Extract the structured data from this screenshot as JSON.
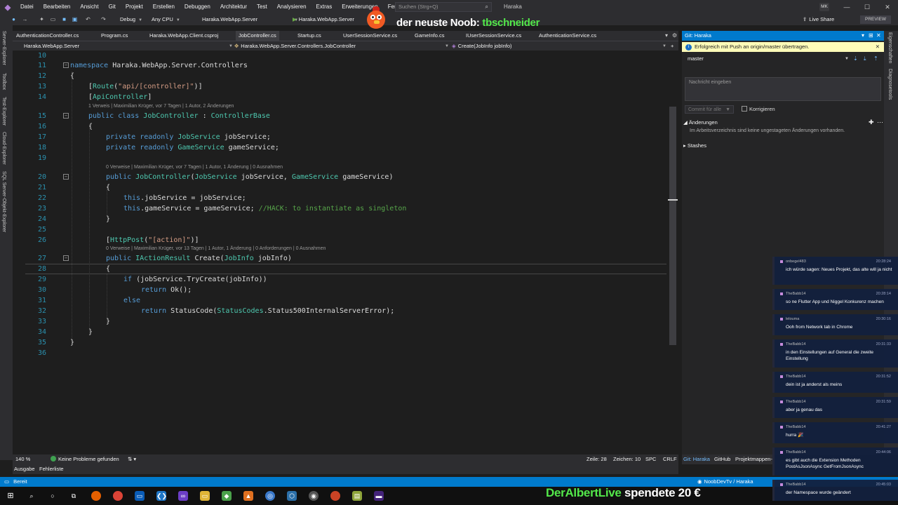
{
  "menu": {
    "items": [
      "Datei",
      "Bearbeiten",
      "Ansicht",
      "Git",
      "Projekt",
      "Erstellen",
      "Debuggen",
      "Architektur",
      "Test",
      "Analysieren",
      "Extras",
      "Erweiterungen",
      "Fenster",
      "Hilfe"
    ],
    "search_placeholder": "Suchen (Strg+Q)",
    "project_name": "Haraka",
    "avatar_initials": "MK"
  },
  "toolbar": {
    "config": "Debug",
    "platform": "Any CPU",
    "startup_project": "Haraka.WebApp.Server",
    "run_target": "Haraka.WebApp.Server",
    "live_share": "Live Share",
    "preview": "PREVIEW"
  },
  "overlay": {
    "title_prefix": "der neuste Noob:",
    "title_user": "tbschneider",
    "donation_user": "DerAlbertLive",
    "donation_text": "spendete 20 €"
  },
  "left_tools": [
    "Server-Explorer",
    "Toolbox",
    "Test-Explorer",
    "Cloud-Explorer",
    "SQL Server-Objekt-Explorer"
  ],
  "doc_tabs": [
    {
      "label": "AuthenticationController.cs",
      "active": false
    },
    {
      "label": "Program.cs",
      "active": false
    },
    {
      "label": "Haraka.WebApp.Client.csproj",
      "active": false
    },
    {
      "label": "JobController.cs",
      "active": true
    },
    {
      "label": "Startup.cs",
      "active": false
    },
    {
      "label": "UserSessionService.cs",
      "active": false
    },
    {
      "label": "GameInfo.cs",
      "active": false
    },
    {
      "label": "IUserSessionService.cs",
      "active": false
    },
    {
      "label": "AuthenticationService.cs",
      "active": false
    }
  ],
  "navbar": {
    "project": "Haraka.WebApp.Server",
    "type": "Haraka.WebApp.Server.Controllers.JobController",
    "member": "Create(JobInfo jobInfo)"
  },
  "codelens": {
    "class": "1 Verweis | Maximilian Krüger, vor 7 Tagen | 1 Autor, 2 Änderungen",
    "ctor": "0 Verweise | Maximilian Krüger, vor 7 Tagen | 1 Autor, 1 Änderung | 0 Ausnahmen",
    "create": "0 Verweise | Maximilian Krüger, vor 13 Tagen | 1 Autor, 1 Änderung | 0 Anforderungen | 0 Ausnahmen"
  },
  "code": {
    "line_numbers": [
      "10",
      "11",
      "12",
      "13",
      "14",
      "15",
      "16",
      "17",
      "18",
      "19",
      "20",
      "21",
      "22",
      "23",
      "24",
      "25",
      "26",
      "27",
      "28",
      "29",
      "30",
      "31",
      "32",
      "33",
      "34",
      "35",
      "36"
    ],
    "kw_namespace": "namespace",
    "ns_name": " Haraka.WebApp.Server.Controllers",
    "open_brace": "{",
    "close_brace": "}",
    "route_open": "[",
    "route_type": "Route",
    "route_paren_open": "(",
    "route_str": "\"api/[controller]\"",
    "route_close": ")]",
    "apictrl_open": "[",
    "apictrl_type": "ApiController",
    "apictrl_close": "]",
    "kw_public": "public",
    "kw_class": "class",
    "class_name": "JobController",
    "colon": " : ",
    "base_class": "ControllerBase",
    "kw_private": "private",
    "kw_readonly": "readonly",
    "type_jobservice": "JobService",
    "field_jobservice": " jobService;",
    "type_gameservice": "GameService",
    "field_gameservice": " gameService;",
    "ctor_name": "JobController",
    "ctor_paren": "(",
    "ctor_p1": " jobService, ",
    "ctor_p2": " gameService)",
    "kw_this": "this",
    "assign1": ".jobService = jobService;",
    "assign2": ".gameService = gameService; ",
    "comment_hack": "//HACK: to instantiate as singleton",
    "httppost_open": "[",
    "httppost_type": "HttpPost",
    "httppost_paren": "(",
    "httppost_str": "\"[action]\"",
    "httppost_close": ")]",
    "iactionresult": "IActionResult",
    "create_name": " Create(",
    "jobinfo_type": "JobInfo",
    "create_param": " jobInfo)",
    "kw_if": "if",
    "if_cond": " (jobService.TryCreate(jobInfo))",
    "kw_return": "return",
    "return_ok": " Ok();",
    "kw_else": "else",
    "return_status_a": " StatusCode(",
    "status_type": "StatusCodes",
    "return_status_b": ".Status500InternalServerError);"
  },
  "editor_footer": {
    "zoom": "140 %",
    "problems": "Keine Probleme gefunden",
    "line": "Zeile: 28",
    "col": "Zeichen: 10",
    "spc": "SPC",
    "eol": "CRLF"
  },
  "bottom_tabs": [
    "Ausgabe",
    "Fehlerliste"
  ],
  "git_panel": {
    "title": "Git: Haraka",
    "info": "Erfolgreich mit Push an origin/master übertragen.",
    "branch": "master",
    "message_placeholder": "Nachricht eingeben",
    "commit_button": "Commit für alle",
    "amend_label": "Korrigieren",
    "changes_title": "Änderungen",
    "changes_empty": "Im Arbeitsverzeichnis sind keine ungestageten Änderungen vorhanden.",
    "stashes_title": "Stashes"
  },
  "right_tools": [
    "Eigenschaften",
    "Diagnosetools"
  ],
  "right_tabs": [
    "Git: Haraka",
    "GitHub",
    "Projektmappen-"
  ],
  "status": {
    "ready": "Bereit",
    "repo": "NoobDevTv / Haraka"
  },
  "chat": [
    {
      "user": "onbegel483",
      "time": "20:28:24",
      "text": "ich würde sagen: Neues Projekt, das alte will ja nicht"
    },
    {
      "user": "TheBabb14",
      "time": "20:28:14",
      "text": "so ne Flutter App und Niggel Konkurenz machen"
    },
    {
      "user": "lelouma",
      "time": "20:30:16",
      "text": "Ooh from Network tab in Chrome"
    },
    {
      "user": "TheBabb14",
      "time": "20:31:33",
      "text": "in den Einstellungen auf General die zweite Einstellung"
    },
    {
      "user": "TheBabb14",
      "time": "20:31:52",
      "text": "dein ist ja anderst als meins"
    },
    {
      "user": "TheBabb14",
      "time": "20:31:59",
      "text": "aber ja genau das"
    },
    {
      "user": "TheBabb14",
      "time": "20:41:27",
      "text": "hurra 🎉"
    },
    {
      "user": "TheBabb14",
      "time": "20:44:06",
      "text": "es gibt auch die Extension Methoden PostAsJsonAsync GetFromJsonAsync"
    },
    {
      "user": "TheBabb14",
      "time": "20:45:03",
      "text": "der Namespace wurde geändert"
    }
  ],
  "colors": {
    "accent": "#007acc",
    "editor_bg": "#1e1e1e",
    "keyword": "#569cd6",
    "type": "#4ec9b0",
    "string": "#d69d85",
    "comment": "#57a64a",
    "line_number": "#2b91af",
    "overlay_green": "#53e84a"
  }
}
